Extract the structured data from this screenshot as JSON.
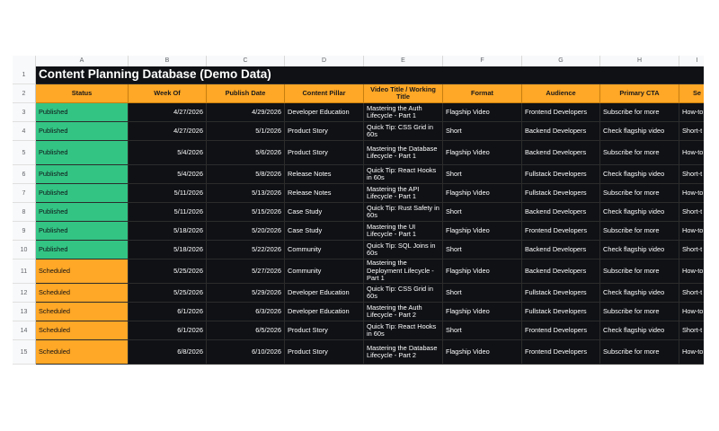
{
  "columns": [
    "A",
    "B",
    "C",
    "D",
    "E",
    "F",
    "G",
    "H",
    "I"
  ],
  "title": "Content Planning Database (Demo Data)",
  "headers": [
    "Status",
    "Week Of",
    "Publish Date",
    "Content Pillar",
    "Video Title / Working Title",
    "Format",
    "Audience",
    "Primary CTA",
    "Se"
  ],
  "row_numbers": [
    "1",
    "2",
    "3",
    "4",
    "5",
    "6",
    "7",
    "8",
    "9",
    "10",
    "11",
    "12",
    "13",
    "14",
    "15"
  ],
  "rows": [
    {
      "status": "Published",
      "week": "4/27/2026",
      "publish": "4/29/2026",
      "pillar": "Developer Education",
      "title": "Mastering the Auth Lifecycle - Part 1",
      "format": "Flagship Video",
      "audience": "Frontend Developers",
      "cta": "Subscribe for more",
      "series": "How-to"
    },
    {
      "status": "Published",
      "week": "4/27/2026",
      "publish": "5/1/2026",
      "pillar": "Product Story",
      "title": "Quick Tip: CSS Grid in 60s",
      "format": "Short",
      "audience": "Backend Developers",
      "cta": "Check flagship video",
      "series": "Short-t"
    },
    {
      "status": "Published",
      "week": "5/4/2026",
      "publish": "5/6/2026",
      "pillar": "Product Story",
      "title": "Mastering the Database Lifecycle - Part 1",
      "format": "Flagship Video",
      "audience": "Backend Developers",
      "cta": "Subscribe for more",
      "series": "How-to"
    },
    {
      "status": "Published",
      "week": "5/4/2026",
      "publish": "5/8/2026",
      "pillar": "Release Notes",
      "title": "Quick Tip: React Hooks in 60s",
      "format": "Short",
      "audience": "Fullstack Developers",
      "cta": "Check flagship video",
      "series": "Short-t"
    },
    {
      "status": "Published",
      "week": "5/11/2026",
      "publish": "5/13/2026",
      "pillar": "Release Notes",
      "title": "Mastering the API Lifecycle - Part 1",
      "format": "Flagship Video",
      "audience": "Fullstack Developers",
      "cta": "Subscribe for more",
      "series": "How-to"
    },
    {
      "status": "Published",
      "week": "5/11/2026",
      "publish": "5/15/2026",
      "pillar": "Case Study",
      "title": "Quick Tip: Rust Safety in 60s",
      "format": "Short",
      "audience": "Backend Developers",
      "cta": "Check flagship video",
      "series": "Short-t"
    },
    {
      "status": "Published",
      "week": "5/18/2026",
      "publish": "5/20/2026",
      "pillar": "Case Study",
      "title": "Mastering the UI Lifecycle - Part 1",
      "format": "Flagship Video",
      "audience": "Frontend Developers",
      "cta": "Subscribe for more",
      "series": "How-to"
    },
    {
      "status": "Published",
      "week": "5/18/2026",
      "publish": "5/22/2026",
      "pillar": "Community",
      "title": "Quick Tip: SQL Joins in 60s",
      "format": "Short",
      "audience": "Backend Developers",
      "cta": "Check flagship video",
      "series": "Short-t"
    },
    {
      "status": "Scheduled",
      "week": "5/25/2026",
      "publish": "5/27/2026",
      "pillar": "Community",
      "title": "Mastering the Deployment Lifecycle - Part 1",
      "format": "Flagship Video",
      "audience": "Backend Developers",
      "cta": "Subscribe for more",
      "series": "How-to"
    },
    {
      "status": "Scheduled",
      "week": "5/25/2026",
      "publish": "5/29/2026",
      "pillar": "Developer Education",
      "title": "Quick Tip: CSS Grid in 60s",
      "format": "Short",
      "audience": "Fullstack Developers",
      "cta": "Check flagship video",
      "series": "Short-t"
    },
    {
      "status": "Scheduled",
      "week": "6/1/2026",
      "publish": "6/3/2026",
      "pillar": "Developer Education",
      "title": "Mastering the Auth Lifecycle - Part 2",
      "format": "Flagship Video",
      "audience": "Fullstack Developers",
      "cta": "Subscribe for more",
      "series": "How-to"
    },
    {
      "status": "Scheduled",
      "week": "6/1/2026",
      "publish": "6/5/2026",
      "pillar": "Product Story",
      "title": "Quick Tip: React Hooks in 60s",
      "format": "Short",
      "audience": "Frontend Developers",
      "cta": "Check flagship video",
      "series": "Short-t"
    },
    {
      "status": "Scheduled",
      "week": "6/8/2026",
      "publish": "6/10/2026",
      "pillar": "Product Story",
      "title": "Mastering the Database Lifecycle - Part 2",
      "format": "Flagship Video",
      "audience": "Frontend Developers",
      "cta": "Subscribe for more",
      "series": "How-to"
    }
  ],
  "colors": {
    "published": "#33c484",
    "scheduled": "#ffa726",
    "dark": "#0f1115"
  }
}
